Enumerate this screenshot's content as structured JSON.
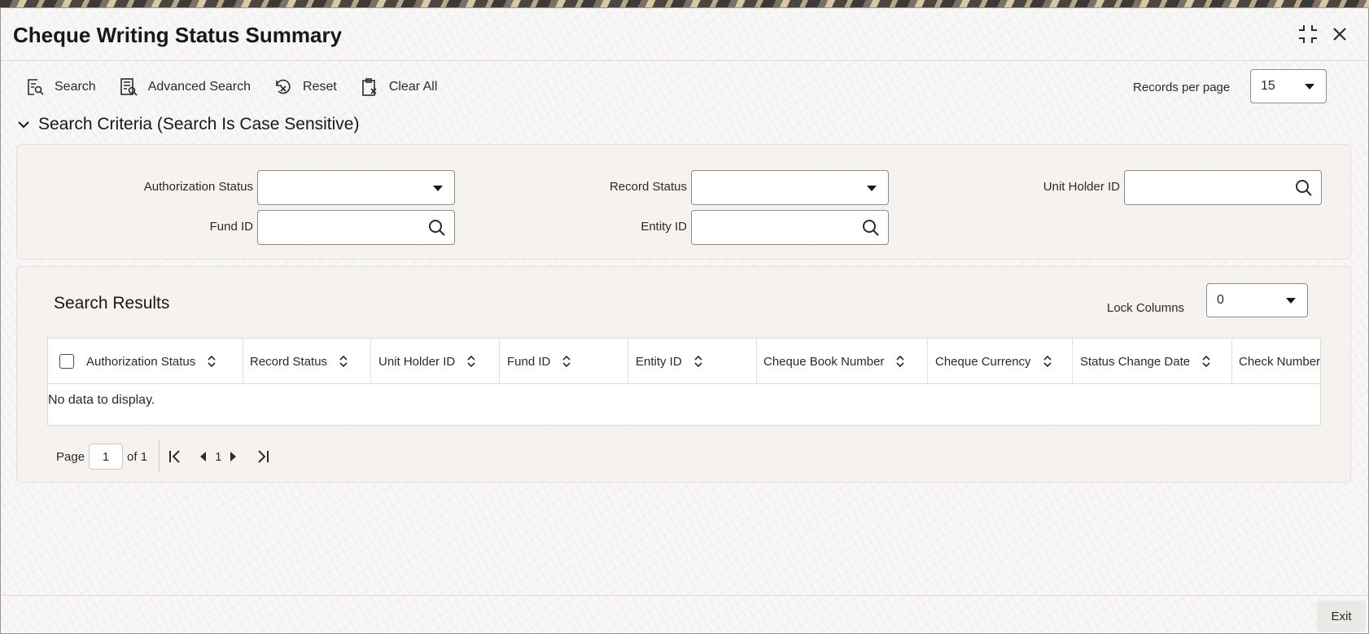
{
  "window": {
    "title": "Cheque Writing Status Summary"
  },
  "toolbar": {
    "search": "Search",
    "advanced_search": "Advanced Search",
    "reset": "Reset",
    "clear_all": "Clear All",
    "records_per_page_label": "Records per page",
    "records_per_page_value": "15"
  },
  "criteria": {
    "heading": "Search Criteria (Search Is Case Sensitive)",
    "authorization_status_label": "Authorization Status",
    "authorization_status_value": "",
    "record_status_label": "Record Status",
    "record_status_value": "",
    "unit_holder_id_label": "Unit Holder ID",
    "unit_holder_id_value": "",
    "fund_id_label": "Fund ID",
    "fund_id_value": "",
    "entity_id_label": "Entity ID",
    "entity_id_value": ""
  },
  "results": {
    "heading": "Search Results",
    "lock_columns_label": "Lock Columns",
    "lock_columns_value": "0",
    "columns": [
      "Authorization Status",
      "Record Status",
      "Unit Holder ID",
      "Fund ID",
      "Entity ID",
      "Cheque Book Number",
      "Cheque Currency",
      "Status Change Date",
      "Check Number"
    ],
    "empty_message": "No data to display."
  },
  "pager": {
    "page_label": "Page",
    "current_page": "1",
    "of_label": "of 1",
    "page_number": "1"
  },
  "footer": {
    "exit": "Exit"
  }
}
